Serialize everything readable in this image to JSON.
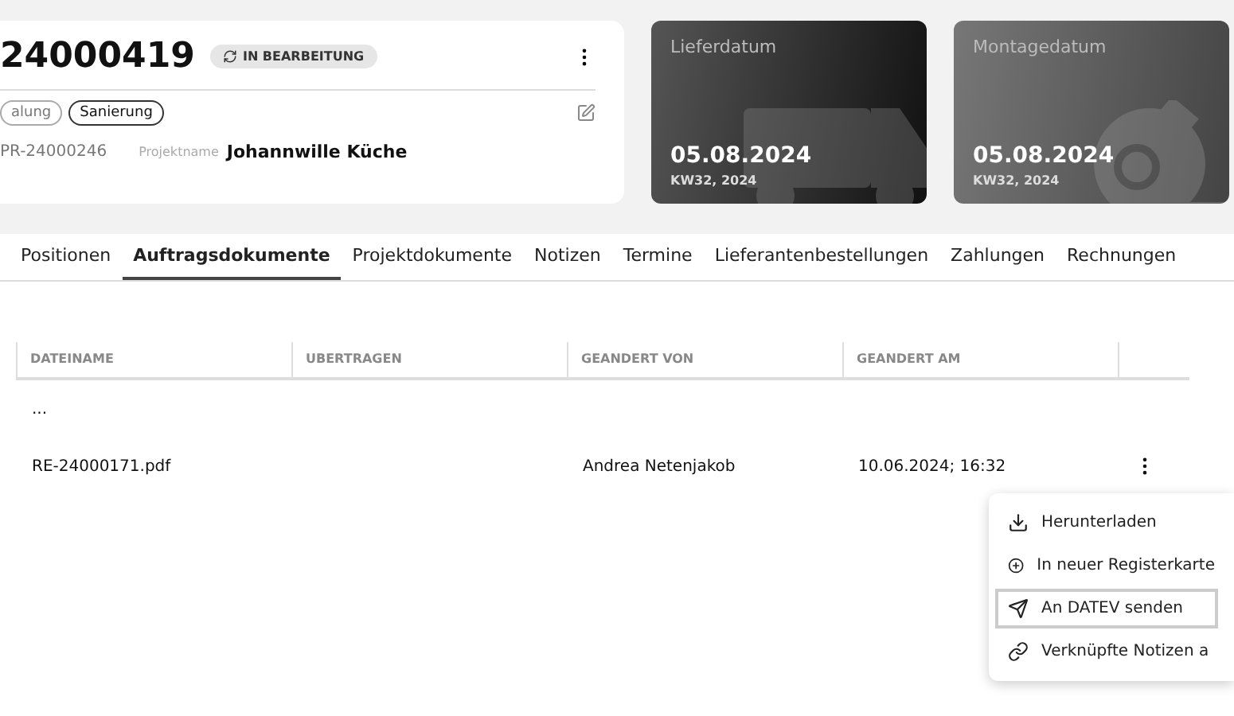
{
  "order": {
    "number": "24000419",
    "status": "IN BEARBEITUNG",
    "tags": [
      "alung",
      "Sanierung"
    ],
    "project_id": "PR-24000246",
    "project_name_label": "Projektname",
    "project_name": "Johannwille Küche"
  },
  "date_cards": [
    {
      "kind": "delivery",
      "label": "Lieferdatum",
      "date": "05.08.2024",
      "week": "KW32, 2024"
    },
    {
      "kind": "assembly",
      "label": "Montagedatum",
      "date": "05.08.2024",
      "week": "KW32, 2024"
    }
  ],
  "tabs": [
    {
      "label": "Positionen",
      "selected": false
    },
    {
      "label": "Auftragsdokumente",
      "selected": true
    },
    {
      "label": "Projektdokumente",
      "selected": false
    },
    {
      "label": "Notizen",
      "selected": false
    },
    {
      "label": "Termine",
      "selected": false
    },
    {
      "label": "Lieferantenbestellungen",
      "selected": false
    },
    {
      "label": "Zahlungen",
      "selected": false
    },
    {
      "label": "Rechnungen",
      "selected": false
    }
  ],
  "table": {
    "columns": [
      "DATEINAME",
      "UBERTRAGEN",
      "GEANDERT VON",
      "GEANDERT AM"
    ],
    "rows": [
      {
        "cells": [
          "...",
          "",
          "",
          ""
        ]
      },
      {
        "cells": [
          "RE-24000171.pdf",
          "",
          "Andrea Netenjakob",
          "10.06.2024; 16:32"
        ]
      }
    ]
  },
  "menu": [
    {
      "kind": "download",
      "label": "Herunterladen",
      "selected": false
    },
    {
      "kind": "plus",
      "label": "In neuer Registerkarte",
      "selected": false
    },
    {
      "kind": "send",
      "label": "An DATEV senden",
      "selected": true
    },
    {
      "kind": "link",
      "label": "Verknüpfte Notizen a",
      "selected": false
    }
  ]
}
